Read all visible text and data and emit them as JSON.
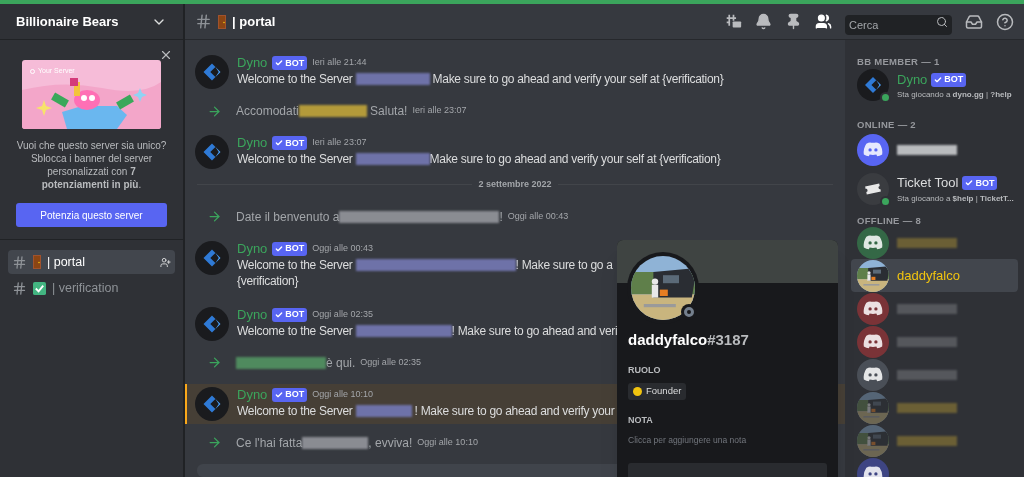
{
  "server": {
    "name": "Billionaire Bears"
  },
  "boost_card": {
    "illustration_title": "Your Server",
    "text": "Vuoi che questo server sia unico? Sblocca i banner del server personalizzati con **7 potenziamenti in più**.",
    "button": "Potenzia questo server"
  },
  "channels": [
    {
      "name": "| portal",
      "selected": true
    },
    {
      "name": "| verification",
      "selected": false
    }
  ],
  "header": {
    "channel": "| portal",
    "search_placeholder": "Cerca"
  },
  "messages": [
    {
      "kind": "bot",
      "author": "Dyno",
      "badge": "BOT",
      "time": "Ieri alle 21:44",
      "highlighted": false,
      "lines": [
        [
          {
            "kind": "text",
            "text": "Welcome to the Server "
          },
          {
            "kind": "redacted",
            "color": "#6e72a8"
          },
          {
            "kind": "text",
            "text": " Make sure to go ahead and verify your self at {verification}"
          }
        ]
      ]
    },
    {
      "kind": "join",
      "time": "Ieri alle 23:07",
      "highlighted": false,
      "lines": [
        [
          {
            "kind": "text",
            "text": "Accomodati"
          },
          {
            "kind": "redacted",
            "color": "#b39a3a"
          },
          {
            "kind": "text",
            "text": " Saluta!"
          }
        ]
      ]
    },
    {
      "kind": "bot",
      "author": "Dyno",
      "badge": "BOT",
      "time": "Ieri alle 23:07",
      "highlighted": false,
      "lines": [
        [
          {
            "kind": "text",
            "text": "Welcome to the Server "
          },
          {
            "kind": "redacted",
            "color": "#6e72a8"
          },
          {
            "kind": "text",
            "text": "Make sure to go ahead and verify your self at {verification}"
          }
        ]
      ]
    },
    {
      "kind": "divider",
      "text": "2 settembre 2022"
    },
    {
      "kind": "join",
      "time": "Oggi alle 00:43",
      "highlighted": false,
      "lines": [
        [
          {
            "kind": "text",
            "text": "Date il benvenuto a"
          },
          {
            "kind": "redacted",
            "color": "#8a8c92"
          },
          {
            "kind": "text",
            "text": "!"
          }
        ]
      ]
    },
    {
      "kind": "bot",
      "author": "Dyno",
      "badge": "BOT",
      "time": "Oggi alle 00:43",
      "highlighted": false,
      "lines": [
        [
          {
            "kind": "text",
            "text": "Welcome to the Server "
          },
          {
            "kind": "redacted",
            "color": "#6e72a8"
          },
          {
            "kind": "text",
            "text": "! Make sure to go a"
          }
        ],
        [
          {
            "kind": "text",
            "text": "{verification}"
          }
        ]
      ]
    },
    {
      "kind": "bot",
      "author": "Dyno",
      "badge": "BOT",
      "time": "Oggi alle 02:35",
      "highlighted": false,
      "lines": [
        [
          {
            "kind": "text",
            "text": "Welcome to the Server "
          },
          {
            "kind": "redacted",
            "color": "#6e72a8"
          },
          {
            "kind": "text",
            "text": "! Make sure to go ahead and veri"
          }
        ]
      ]
    },
    {
      "kind": "join",
      "time": "Oggi alle 02:35",
      "highlighted": false,
      "lines": [
        [
          {
            "kind": "redacted",
            "color": "#4f8a5e"
          },
          {
            "kind": "text",
            "text": "è qui."
          }
        ]
      ]
    },
    {
      "kind": "bot",
      "author": "Dyno",
      "badge": "BOT",
      "time": "Oggi alle 10:10",
      "highlighted": true,
      "lines": [
        [
          {
            "kind": "text",
            "text": "Welcome to the Server "
          },
          {
            "kind": "redacted",
            "color": "#6e72a8"
          },
          {
            "kind": "text",
            "text": " ! Make sure to go ahead and verify your"
          }
        ]
      ]
    },
    {
      "kind": "join",
      "time": "Oggi alle 10:10",
      "highlighted": false,
      "lines": [
        [
          {
            "kind": "text",
            "text": "Ce l'hai fatta"
          },
          {
            "kind": "redacted",
            "color": "#8a8c92"
          },
          {
            "kind": "text",
            "text": ", evviva!"
          }
        ]
      ]
    }
  ],
  "member_groups": [
    {
      "title": "BB MEMBER — 1",
      "members": [
        {
          "avatar": {
            "kind": "dyno"
          },
          "online": true,
          "selected": false,
          "name": "Dyno",
          "color": "#3ba55c",
          "badge": "BOT",
          "activity": "Sta giocando a **dyno.gg** | **?help**"
        }
      ]
    },
    {
      "title": "ONLINE — 2",
      "members": [
        {
          "avatar": {
            "kind": "discord",
            "color": "#5865f2"
          },
          "selected": false,
          "color": "#b9bbbe"
        },
        {
          "avatar": {
            "kind": "ticket"
          },
          "online": true,
          "selected": false,
          "name": "Ticket Tool",
          "color": "#dcddde",
          "badge": "BOT",
          "activity": "Sta giocando a **$help** | **TicketT...**"
        }
      ]
    },
    {
      "title": "OFFLINE — 8",
      "members": [
        {
          "avatar": {
            "kind": "discord",
            "color": "#346846"
          },
          "selected": false,
          "color": "#6b5f35"
        },
        {
          "selected": true,
          "name": "daddyfalco",
          "color": "#f1c40f"
        },
        {
          "avatar": {
            "kind": "discord",
            "color": "#7a3337"
          },
          "selected": false,
          "color": "#55575c"
        },
        {
          "avatar": {
            "kind": "discord",
            "color": "#7a3337"
          },
          "selected": false,
          "color": "#55575c"
        },
        {
          "avatar": {
            "kind": "discord",
            "color": "#4a4f57"
          },
          "selected": false,
          "color": "#55575c"
        },
        {
          "selected": false,
          "color": "#6b5f35"
        },
        {
          "selected": false,
          "color": "#6b5f35"
        },
        {
          "avatar": {
            "kind": "discord",
            "color": "#3e4583"
          },
          "selected": false
        }
      ]
    }
  ],
  "profile": {
    "name": "daddyfalco",
    "discriminator": "#3187",
    "role_heading": "RUOLO",
    "roles": [
      {
        "name": "Founder",
        "color": "#f1c40f"
      }
    ],
    "note_heading": "NOTA",
    "note_placeholder": "Clicca per aggiungere una nota"
  }
}
